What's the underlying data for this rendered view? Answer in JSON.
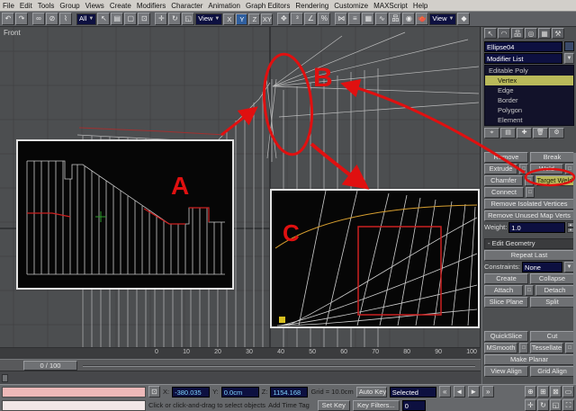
{
  "menu": {
    "items": [
      "File",
      "Edit",
      "Tools",
      "Group",
      "Views",
      "Create",
      "Modifiers",
      "Character",
      "Animation",
      "Graph Editors",
      "Rendering",
      "Customize",
      "MAXScript",
      "Help"
    ]
  },
  "toolbar": {
    "selection_filter": "All",
    "coord_system": "View",
    "axis_x": "X",
    "axis_y": "Y",
    "axis_z": "Z",
    "axis_xy": "XY",
    "render_type": "View"
  },
  "viewport": {
    "label": "Front"
  },
  "annotations": {
    "label_a": "A",
    "label_b": "B",
    "label_c": "C"
  },
  "command_panel": {
    "object_name": "Ellipse04",
    "modifier_list": "Modifier List",
    "stack": {
      "root": "Editable Poly",
      "items": [
        "Vertex",
        "Edge",
        "Border",
        "Polygon",
        "Element"
      ],
      "selected": "Vertex"
    },
    "edit_vertices": {
      "remove": "Remove",
      "break": "Break",
      "extrude": "Extrude",
      "weld": "Weld",
      "chamfer": "Chamfer",
      "target_weld": "Target Weld",
      "connect": "Connect",
      "remove_isolated": "Remove Isolated Vertices",
      "remove_unused": "Remove Unused Map Verts",
      "weight_label": "Weight:",
      "weight_value": "1.0"
    },
    "edit_geometry": {
      "header": "- Edit Geometry",
      "repeat_last": "Repeat Last",
      "constraints_label": "Constraints:",
      "constraints_value": "None",
      "create": "Create",
      "collapse": "Collapse",
      "attach": "Attach",
      "detach": "Detach",
      "slice_plane": "Slice Plane",
      "split": "Split",
      "quickslice": "QuickSlice",
      "cut": "Cut",
      "msmooth": "MSmooth",
      "tessellate": "Tessellate",
      "make_planar": "Make Planar",
      "view_align": "View Align",
      "grid_align": "Grid Align"
    }
  },
  "timeline": {
    "slider_label": "0 / 100",
    "ticks": [
      "0",
      "10",
      "20",
      "30",
      "40",
      "50",
      "60",
      "70",
      "80",
      "90",
      "100"
    ]
  },
  "status_bar": {
    "coords": {
      "x_label": "X:",
      "x_value": "-380.035",
      "y_label": "Y:",
      "y_value": "0.0cm",
      "z_label": "Z:",
      "z_value": "1154.168"
    },
    "grid_label": "Grid = 10.0cm",
    "prompt": "Click or click-and-drag to select objects",
    "time_tag": "Add Time Tag",
    "auto_key": "Auto Key",
    "selection_set": "Selected",
    "set_key": "Set Key",
    "key_filters": "Key Filters...",
    "frame": "0"
  },
  "colors": {
    "annotation_red": "#e01010",
    "highlight_yellow": "#b9b95a",
    "field_navy": "#0d1040",
    "value_cyan": "#7fd4ff"
  }
}
